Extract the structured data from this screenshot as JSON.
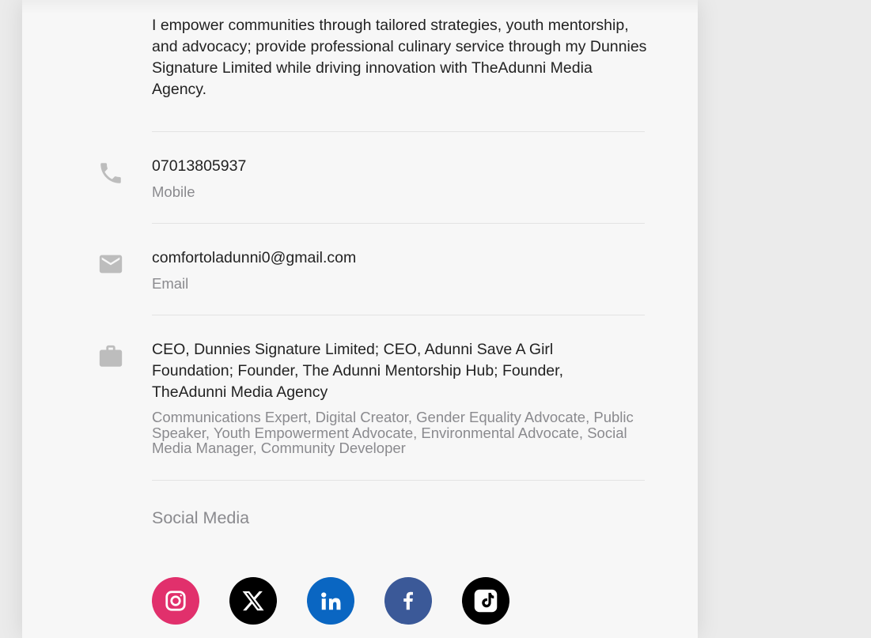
{
  "profile": {
    "bio": "I empower communities through tailored strategies, youth mentorship, and advocacy; provide professional culinary service through my Dunnies Signature Limited while driving innovation with TheAdunni Media Agency.",
    "phone": {
      "value": "07013805937",
      "label": "Mobile",
      "icon": "phone-icon"
    },
    "email": {
      "value": "comfortoladunni0@gmail.com",
      "label": "Email",
      "icon": "mail-icon"
    },
    "work": {
      "title": "CEO, Dunnies Signature Limited; CEO, Adunni Save A Girl Foundation; Founder, The Adunni Mentorship Hub; Founder, TheAdunni Media Agency",
      "roles": "Communications Expert, Digital Creator, Gender Equality Advocate, Public Speaker, Youth Empowerment Advocate, Environmental Advocate, Social Media Manager, Community Developer",
      "icon": "briefcase-icon"
    }
  },
  "social": {
    "heading": "Social Media",
    "links": [
      {
        "icon": "instagram-icon",
        "color": "#e1306c"
      },
      {
        "icon": "x-icon",
        "color": "#000000"
      },
      {
        "icon": "linkedin-icon",
        "color": "#0a66c2"
      },
      {
        "icon": "facebook-icon",
        "color": "#3b5998"
      },
      {
        "icon": "tiktok-icon",
        "color": "#000000"
      }
    ]
  },
  "colors": {
    "card_bg": "#f7f7f7",
    "icon_gray": "#bdbdbd",
    "muted_text": "#8a8a8e"
  }
}
